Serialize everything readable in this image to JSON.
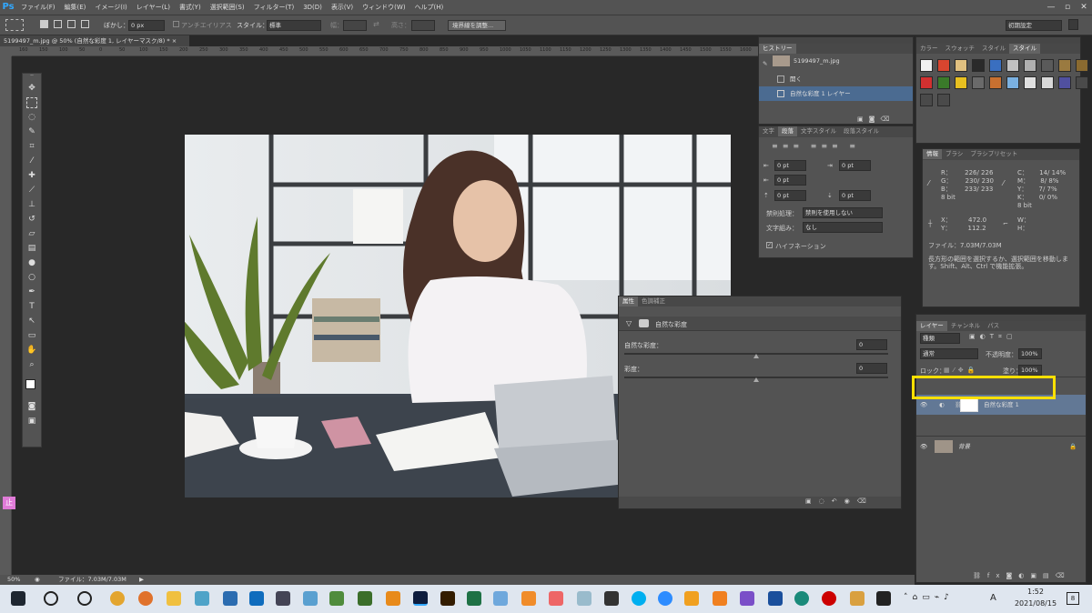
{
  "menubar": {
    "logo": "Ps",
    "items": [
      "ファイル(F)",
      "編集(E)",
      "イメージ(I)",
      "レイヤー(L)",
      "書式(Y)",
      "選択範囲(S)",
      "フィルター(T)",
      "3D(D)",
      "表示(V)",
      "ウィンドウ(W)",
      "ヘルプ(H)"
    ],
    "minimize": "—",
    "maximize": "▫",
    "close": "✕"
  },
  "options": {
    "feather_label": "ぼかし：",
    "feather_value": "0 px",
    "antialias": "アンチエイリアス",
    "style_label": "スタイル：",
    "style_value": "標準",
    "width_label": "幅：",
    "height_label": "高さ：",
    "refine_edge": "境界線を調整...",
    "workspace": "初期設定"
  },
  "document": {
    "tab_title": "5199497_m.jpg @ 50% (自然な彩度 1, レイヤーマスク/8) *",
    "close": "×"
  },
  "ruler": {
    "ticks": [
      "160",
      "150",
      "100",
      "50",
      "0",
      "50",
      "100",
      "150",
      "200",
      "250",
      "300",
      "350",
      "400",
      "450",
      "500",
      "550",
      "600",
      "650",
      "700",
      "750",
      "800",
      "850",
      "900",
      "950",
      "1000",
      "1050",
      "1100",
      "1150",
      "1200",
      "1250",
      "1300",
      "1350",
      "1400",
      "1450",
      "1500",
      "1550",
      "1600",
      "1650"
    ]
  },
  "status": {
    "zoom": "50%",
    "file": "ファイル：7.03M/7.03M"
  },
  "history": {
    "tab": "ヒストリー",
    "snapshot": "5199497_m.jpg",
    "rows": [
      "開く",
      "自然な彩度 1 レイヤー"
    ]
  },
  "paragraph": {
    "tabs": [
      "文字",
      "段落",
      "文字スタイル",
      "段落スタイル"
    ],
    "indent_left": "0 pt",
    "indent_right": "0 pt",
    "indent_first": "0 pt",
    "space_before": "0 pt",
    "space_after": "0 pt",
    "kinsoku_label": "禁則処理：",
    "kinsoku_value": "禁則を使用しない",
    "mojikumi_label": "文字組み：",
    "mojikumi_value": "なし",
    "hyphenation": "ハイフネーション"
  },
  "swatches": {
    "tabs": [
      "カラー",
      "スウォッチ",
      "スタイル",
      "スタイル"
    ]
  },
  "info": {
    "tabs": [
      "情報",
      "ブラシ",
      "ブラシプリセット"
    ],
    "r": "R：",
    "g": "G：",
    "b": "B：",
    "r_val": "226/ 226",
    "g_val": "230/ 230",
    "b_val": "233/ 233",
    "bit1": "8 bit",
    "c": "C：",
    "m": "M：",
    "y": "Y：",
    "k": "K：",
    "c_val": "14/ 14%",
    "m_val": "8/ 8%",
    "y_val": "7/ 7%",
    "k_val": "0/ 0%",
    "bit2": "8 bit",
    "x": "X：",
    "yy": "Y：",
    "x_val": "472.0",
    "y_val2": "112.2",
    "w": "W：",
    "h": "H：",
    "file": "ファイル：7.03M/7.03M",
    "hint": "長方形の範囲を選択するか、選択範囲を移動します。Shift、Alt、Ctrl で機能拡張。"
  },
  "properties": {
    "tabs": [
      "属性",
      "色調補正"
    ],
    "title": "自然な彩度",
    "vibrance_label": "自然な彩度：",
    "vibrance_value": "0",
    "saturation_label": "彩度：",
    "saturation_value": "0"
  },
  "layers": {
    "tabs": [
      "レイヤー",
      "チャンネル",
      "パス"
    ],
    "kind": "種類",
    "blend": "通常",
    "opacity_label": "不透明度：",
    "opacity_value": "100%",
    "lock_label": "ロック：",
    "fill_label": "塗り：",
    "fill_value": "100%",
    "rows": [
      {
        "name": "自然な彩度 1"
      },
      {
        "name": "背景"
      }
    ]
  },
  "taskbar": {
    "time": "1:52",
    "date": "2021/08/15",
    "ime": "A",
    "notif": "8"
  },
  "colors": {
    "accent": "#31a8ff",
    "highlight": "#ffe000",
    "selected_row": "#4b6b91"
  }
}
